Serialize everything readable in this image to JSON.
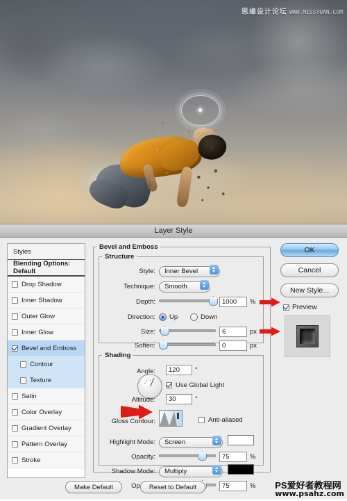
{
  "photo": {
    "watermark_cn": "思缘设计论坛",
    "watermark_url": "WWW.MISSYUAN.COM"
  },
  "dialog": {
    "title": "Layer Style"
  },
  "styles_panel": {
    "header": "Styles",
    "blending_options": "Blending Options: Default",
    "items": [
      {
        "label": "Drop Shadow",
        "checked": false,
        "selected": false,
        "sub": false
      },
      {
        "label": "Inner Shadow",
        "checked": false,
        "selected": false,
        "sub": false
      },
      {
        "label": "Outer Glow",
        "checked": false,
        "selected": false,
        "sub": false
      },
      {
        "label": "Inner Glow",
        "checked": false,
        "selected": false,
        "sub": false
      },
      {
        "label": "Bevel and Emboss",
        "checked": true,
        "selected": true,
        "sub": false
      },
      {
        "label": "Contour",
        "checked": false,
        "selected": false,
        "sub": true
      },
      {
        "label": "Texture",
        "checked": false,
        "selected": false,
        "sub": true
      },
      {
        "label": "Satin",
        "checked": false,
        "selected": false,
        "sub": false
      },
      {
        "label": "Color Overlay",
        "checked": false,
        "selected": false,
        "sub": false
      },
      {
        "label": "Gradient Overlay",
        "checked": false,
        "selected": false,
        "sub": false
      },
      {
        "label": "Pattern Overlay",
        "checked": false,
        "selected": false,
        "sub": false
      },
      {
        "label": "Stroke",
        "checked": false,
        "selected": false,
        "sub": false
      }
    ]
  },
  "main": {
    "section_title": "Bevel and Emboss",
    "structure": {
      "legend": "Structure",
      "style_label": "Style:",
      "style_value": "Inner Bevel",
      "technique_label": "Technique:",
      "technique_value": "Smooth",
      "depth_label": "Depth:",
      "depth_value": "1000",
      "depth_unit": "%",
      "direction_label": "Direction:",
      "direction_up": "Up",
      "direction_down": "Down",
      "direction_selected": "Up",
      "size_label": "Size:",
      "size_value": "6",
      "size_unit": "px",
      "soften_label": "Soften:",
      "soften_value": "0",
      "soften_unit": "px"
    },
    "shading": {
      "legend": "Shading",
      "angle_label": "Angle:",
      "angle_value": "120",
      "angle_unit": "°",
      "global_light_label": "Use Global Light",
      "global_light_checked": true,
      "altitude_label": "Altitude:",
      "altitude_value": "30",
      "altitude_unit": "°",
      "gloss_contour_label": "Gloss Contour:",
      "anti_aliased_label": "Anti-aliased",
      "anti_aliased_checked": false,
      "highlight_mode_label": "Highlight Mode:",
      "highlight_mode_value": "Screen",
      "highlight_color": "#ffffff",
      "highlight_opacity_label": "Opacity:",
      "highlight_opacity_value": "75",
      "highlight_opacity_unit": "%",
      "shadow_mode_label": "Shadow Mode:",
      "shadow_mode_value": "Multiply",
      "shadow_color": "#000000",
      "shadow_opacity_label": "Opacity:",
      "shadow_opacity_value": "75",
      "shadow_opacity_unit": "%"
    }
  },
  "right_panel": {
    "ok": "OK",
    "cancel": "Cancel",
    "new_style": "New Style...",
    "preview_label": "Preview",
    "preview_checked": true
  },
  "footer": {
    "make_default": "Make Default",
    "reset_to_default": "Reset to Default",
    "watermark_cn": "PS爱好者教程网",
    "watermark_url": "www.psahz.com"
  },
  "colors": {
    "selection_blue": "#b8d8f5",
    "arrow_red": "#e01b18",
    "dialog_bg": "#ececec"
  }
}
